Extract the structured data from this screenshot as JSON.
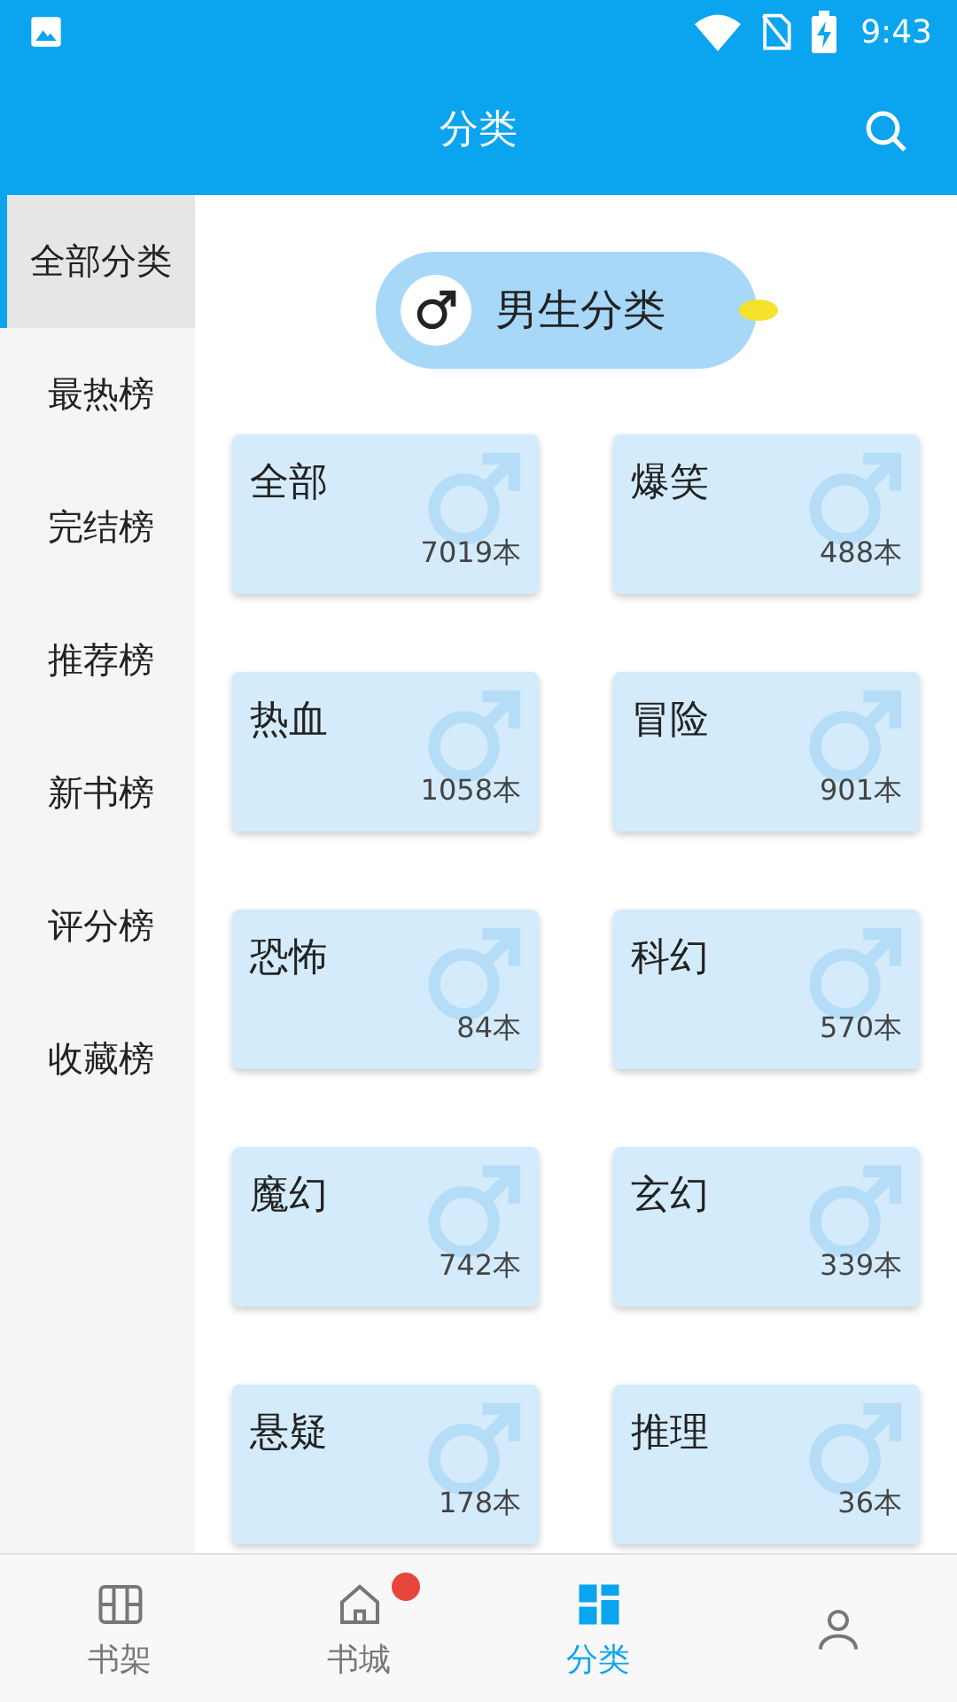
{
  "status_bar": {
    "time": "9:43"
  },
  "header": {
    "title": "分类"
  },
  "sidebar": {
    "items": [
      {
        "label": "全部分类",
        "selected": true
      },
      {
        "label": "最热榜",
        "selected": false
      },
      {
        "label": "完结榜",
        "selected": false
      },
      {
        "label": "推荐榜",
        "selected": false
      },
      {
        "label": "新书榜",
        "selected": false
      },
      {
        "label": "评分榜",
        "selected": false
      },
      {
        "label": "收藏榜",
        "selected": false
      }
    ]
  },
  "gender_toggle": {
    "label": "男生分类"
  },
  "categories": [
    {
      "name": "全部",
      "count": "7019本"
    },
    {
      "name": "爆笑",
      "count": "488本"
    },
    {
      "name": "热血",
      "count": "1058本"
    },
    {
      "name": "冒险",
      "count": "901本"
    },
    {
      "name": "恐怖",
      "count": "84本"
    },
    {
      "name": "科幻",
      "count": "570本"
    },
    {
      "name": "魔幻",
      "count": "742本"
    },
    {
      "name": "玄幻",
      "count": "339本"
    },
    {
      "name": "悬疑",
      "count": "178本"
    },
    {
      "name": "推理",
      "count": "36本"
    }
  ],
  "bottom_nav": [
    {
      "kind": "bookshelf",
      "label": "书架",
      "selected": false,
      "badge": false
    },
    {
      "kind": "home",
      "label": "书城",
      "selected": false,
      "badge": true
    },
    {
      "kind": "grid",
      "label": "分类",
      "selected": true,
      "badge": false
    },
    {
      "kind": "person",
      "selected": false,
      "badge": false
    }
  ]
}
